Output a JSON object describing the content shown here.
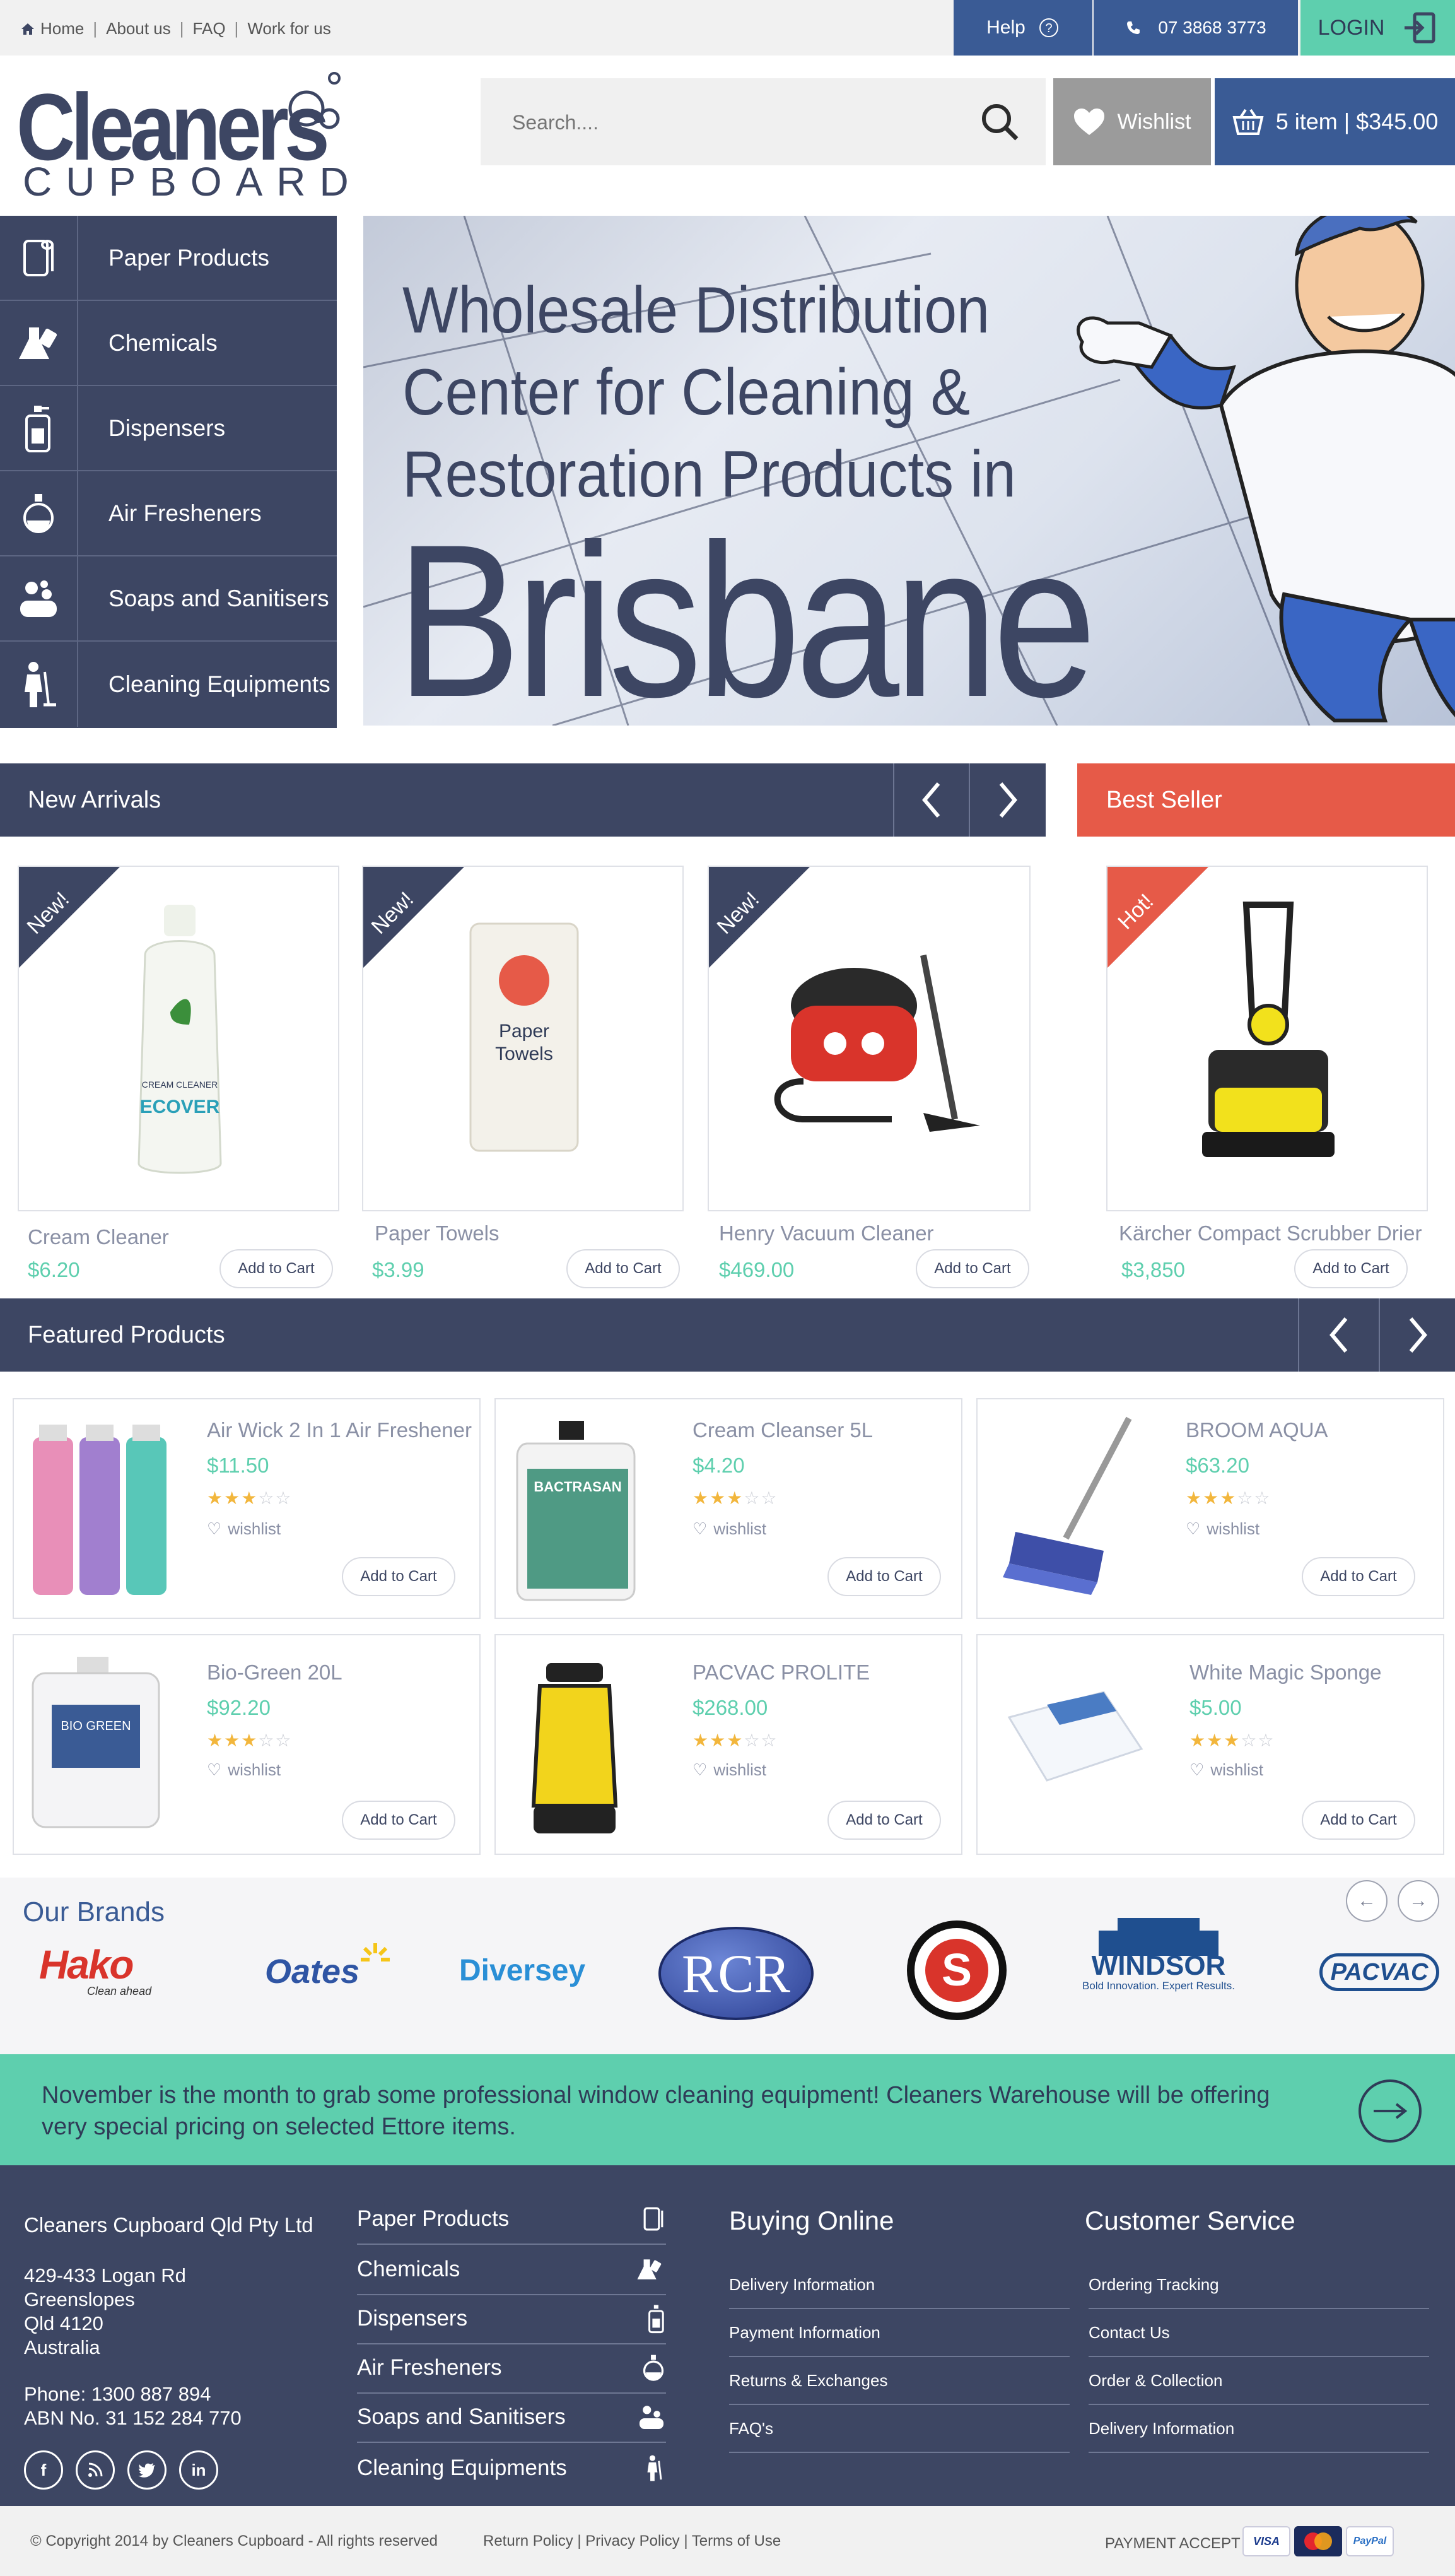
{
  "topbar": {
    "links": [
      "Home",
      "About us",
      "FAQ",
      "Work for us"
    ],
    "help_label": "Help",
    "phone": "07 3868 3773",
    "login_label": "LOGIN"
  },
  "header": {
    "logo_main": "Cleaners",
    "logo_sub": "CUPBOARD",
    "search_placeholder": "Search....",
    "wishlist_label": "Wishlist",
    "cart_label": "5 item |  $345.00"
  },
  "sidebar": {
    "items": [
      {
        "label": "Paper Products",
        "icon": "paper-roll-icon"
      },
      {
        "label": "Chemicals",
        "icon": "chemical-flask-icon"
      },
      {
        "label": "Dispensers",
        "icon": "dispenser-icon"
      },
      {
        "label": "Air Fresheners",
        "icon": "air-freshener-icon"
      },
      {
        "label": "Soaps and Sanitisers",
        "icon": "soap-icon"
      },
      {
        "label": "Cleaning Equipments",
        "icon": "cleaner-icon"
      }
    ]
  },
  "hero": {
    "lines": [
      "Wholesale Distribution",
      "Center for Cleaning &",
      "Restoration Products in"
    ],
    "big": "Brisbane"
  },
  "new_arrivals": {
    "title": "New Arrivals",
    "best_seller_title": "Best Seller",
    "products": [
      {
        "badge": "New!",
        "name": "Cream Cleaner",
        "price": "$6.20",
        "button": "Add to Cart"
      },
      {
        "badge": "New!",
        "name": "Paper Towels",
        "price": "$3.99",
        "button": "Add to Cart"
      },
      {
        "badge": "New!",
        "name": "Henry Vacuum Cleaner",
        "price": "$469.00",
        "button": "Add to Cart"
      }
    ],
    "best_seller": {
      "badge": "Hot!",
      "name": "Kärcher Compact Scrubber Drier",
      "price": "$3,850",
      "button": "Add to Cart"
    }
  },
  "featured": {
    "title": "Featured Products",
    "products": [
      {
        "name": "Air Wick 2 In 1 Air Freshener",
        "price": "$11.50",
        "rating": 3,
        "wishlist": "wishlist",
        "button": "Add to Cart"
      },
      {
        "name": "Cream Cleanser 5L",
        "price": "$4.20",
        "rating": 3,
        "wishlist": "wishlist",
        "button": "Add to Cart"
      },
      {
        "name": "BROOM AQUA",
        "price": "$63.20",
        "rating": 3,
        "wishlist": "wishlist",
        "button": "Add to Cart"
      },
      {
        "name": "Bio-Green 20L",
        "price": "$92.20",
        "rating": 3,
        "wishlist": "wishlist",
        "button": "Add to Cart"
      },
      {
        "name": "PACVAC PROLITE",
        "price": "$268.00",
        "rating": 3,
        "wishlist": "wishlist",
        "button": "Add to Cart"
      },
      {
        "name": "White Magic Sponge",
        "price": "$5.00",
        "rating": 3,
        "wishlist": "wishlist",
        "button": "Add to Cart"
      }
    ]
  },
  "brands": {
    "title": "Our Brands",
    "items": [
      "Hako",
      "Clean ahead",
      "Oates",
      "Diversey",
      "RCR",
      "S",
      "WINDSOR",
      "Bold Innovation. Expert Results.",
      "PACVAC"
    ]
  },
  "promo": {
    "text": "November is the month to grab some professional window cleaning equipment! Cleaners Warehouse will be offering very special pricing on selected Ettore items."
  },
  "footer": {
    "company": "Cleaners Cupboard Qld Pty Ltd",
    "address": [
      "429-433 Logan Rd",
      "Greenslopes",
      "Qld 4120",
      "Australia"
    ],
    "phone": "Phone:  1300 887 894",
    "abn": "ABN No. 31 152 284 770",
    "categories": [
      "Paper Products",
      "Chemicals",
      "Dispensers",
      "Air Fresheners",
      "Soaps and Sanitisers",
      "Cleaning Equipments"
    ],
    "buying_title": "Buying Online",
    "buying_links": [
      "Delivery Information",
      "Payment Information",
      "Returns & Exchanges",
      "FAQ's"
    ],
    "service_title": "Customer Service",
    "service_links": [
      "Ordering Tracking",
      "Contact Us",
      "Order & Collection",
      "Delivery Information"
    ]
  },
  "bottom": {
    "copyright": "© Copyright 2014 by Cleaners Cupboard - All rights reserved",
    "policies": "Return Policy | Privacy Policy | Terms of Use",
    "payment_label": "PAYMENT ACCEPT",
    "cards": [
      "VISA",
      "MasterCard",
      "PayPal"
    ]
  },
  "colors": {
    "navy": "#3d4663",
    "blue": "#3a5b95",
    "mint": "#5ecfae",
    "red": "#e65a48"
  }
}
